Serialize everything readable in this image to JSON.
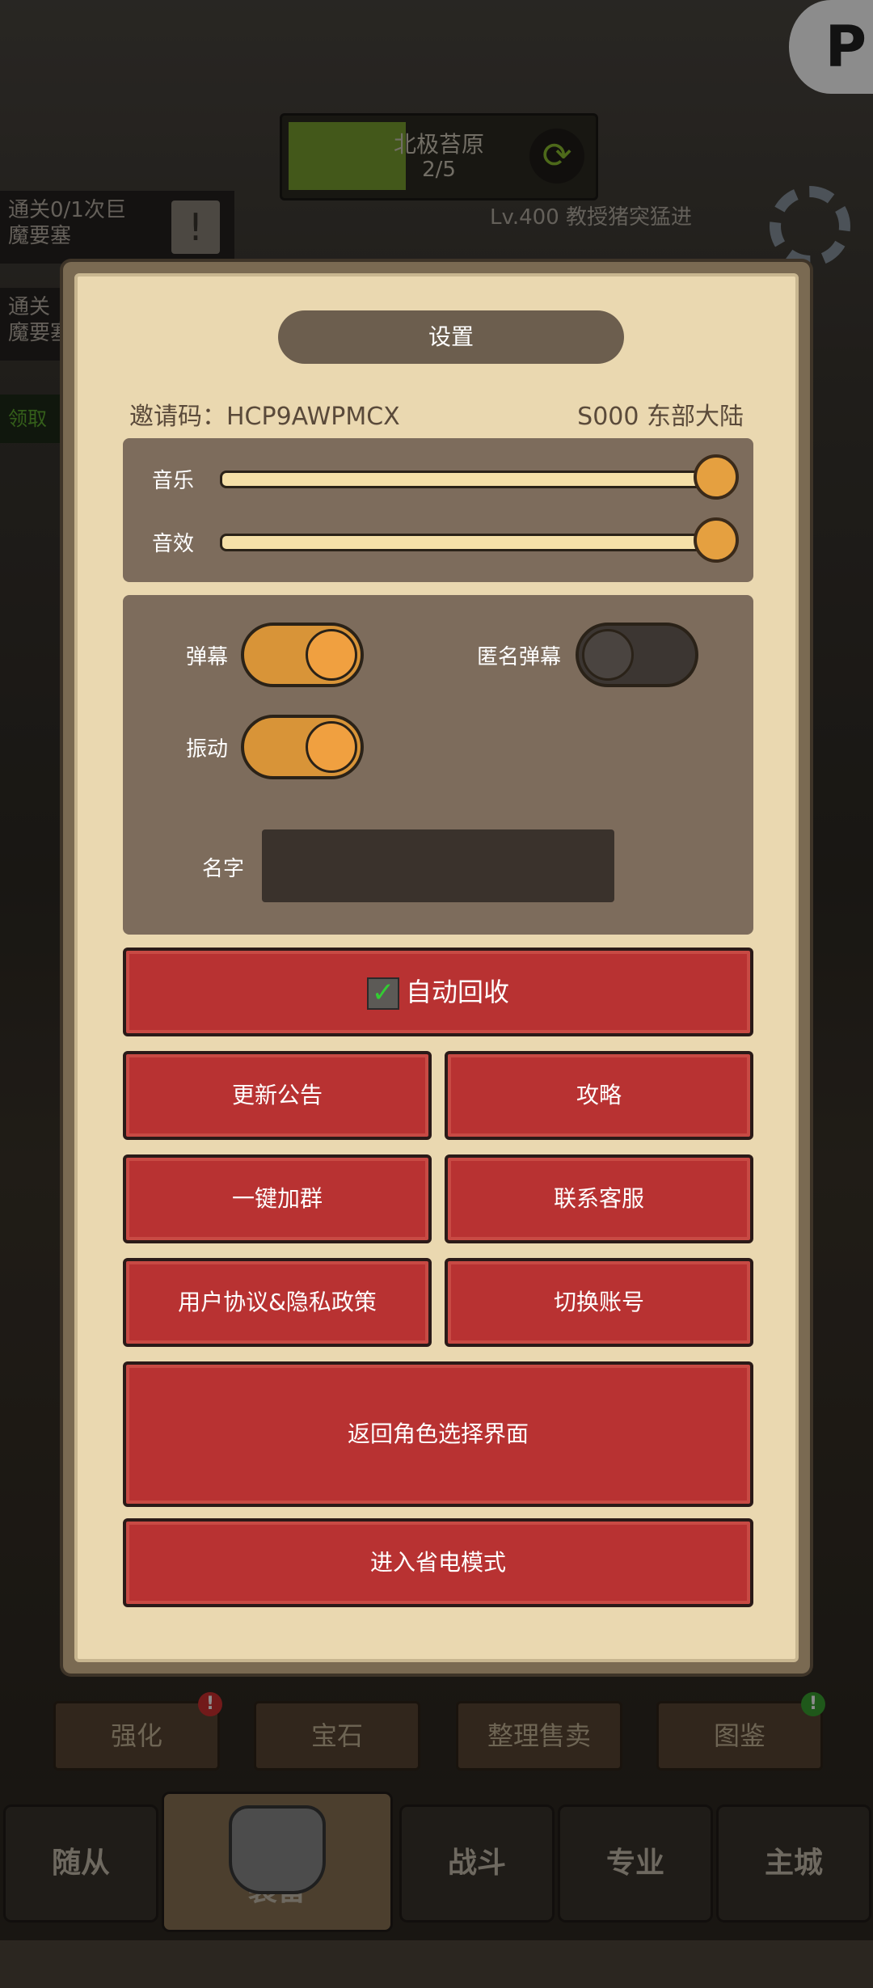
{
  "background": {
    "stage": {
      "name": "北极苔原",
      "progress": "2/5"
    },
    "quests": [
      {
        "line1": "通关0/1次巨",
        "line2": "魔要塞"
      },
      {
        "line1": "通关",
        "line2": "魔要塞"
      }
    ],
    "claim_label": "领取",
    "boss_info": "Lv.400 教授猪突猛进",
    "sub_tabs": [
      "强化",
      "宝石",
      "整理售卖",
      "图鉴"
    ],
    "bottom_tabs": [
      "随从",
      "装备",
      "战斗",
      "专业",
      "主城"
    ],
    "badge_color_alert": "#d03030",
    "badge_color_ok": "#3aa030"
  },
  "settings": {
    "title": "设置",
    "invite_code": "邀请码：HCP9AWPMCX",
    "server": "S000 东部大陆",
    "music_label": "音乐",
    "sound_label": "音效",
    "music_level": 1.0,
    "sound_level": 1.0,
    "danmaku_label": "弹幕",
    "danmaku_on": true,
    "anon_danmaku_label": "匿名弹幕",
    "anon_danmaku_on": false,
    "vibration_label": "振动",
    "vibration_on": true,
    "name_label": "名字",
    "name_value": "",
    "auto_recycle_label": "自动回收",
    "auto_recycle_checked": true,
    "buttons": {
      "update_notice": "更新公告",
      "guide": "攻略",
      "join_group": "一键加群",
      "contact_service": "联系客服",
      "user_agreement": "用户协议&隐私政策",
      "switch_account": "切换账号",
      "back_to_role_select": "返回角色选择界面",
      "power_save": "进入省电模式"
    }
  },
  "colors": {
    "panel_bg": "#ead8b0",
    "button_red": "#b83232",
    "toggle_on": "#d89438",
    "toggle_off": "#3c3632"
  }
}
